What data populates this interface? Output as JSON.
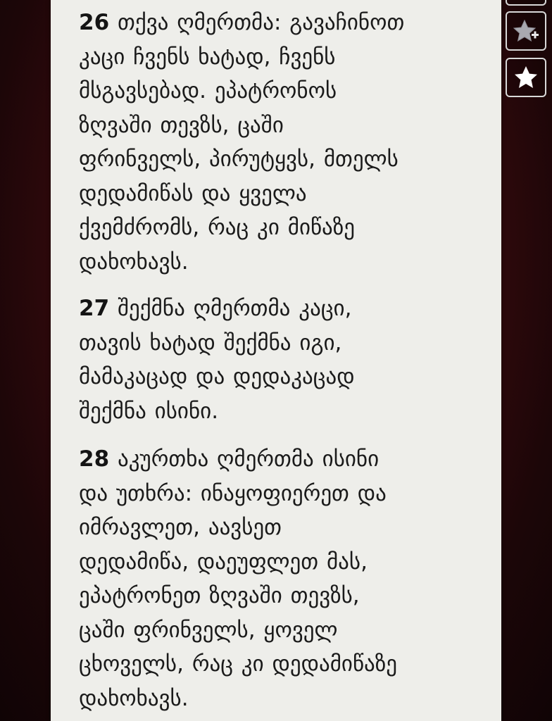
{
  "verses": [
    {
      "number": "26",
      "lines": [
        "თქვა ღმერთმა: გავაჩინოთ",
        "კაცი ჩვენს ხატად, ჩვენს",
        "მსგავსებად. ეპატრონოს",
        "ზღვაში თევზს, ცაში",
        "ფრინველს, პირუტყვს, მთელს",
        "დედამიწას და ყველა",
        "ქვემძრომს, რაც კი მიწაზე",
        "დახოხავს."
      ]
    },
    {
      "number": "27",
      "lines": [
        "შექმნა ღმერთმა კაცი,",
        "თავის ხატად შექმნა იგი,",
        "მამაკაცად და დედაკაცად",
        "შექმნა ისინი."
      ]
    },
    {
      "number": "28",
      "lines": [
        "აკურთხა ღმერთმა ისინი",
        "და უთხრა: ინაყოფიერეთ და",
        "იმრავლეთ, აავსეთ",
        "დედამიწა, დაეუფლეთ მას,",
        "ეპატრონეთ ზღვაში თევზს,",
        "ცაში ფრინველს, ყოველ",
        "ცხოველს, რაც კი დედამიწაზე",
        "დახოხავს."
      ]
    }
  ],
  "side_buttons": {
    "add_bookmark_icon": "star-plus-icon",
    "bookmarks_icon": "star-icon"
  },
  "colors": {
    "page_background": "#eeeeea",
    "text": "#1a1a1a",
    "backdrop": "#3a0a0e"
  }
}
